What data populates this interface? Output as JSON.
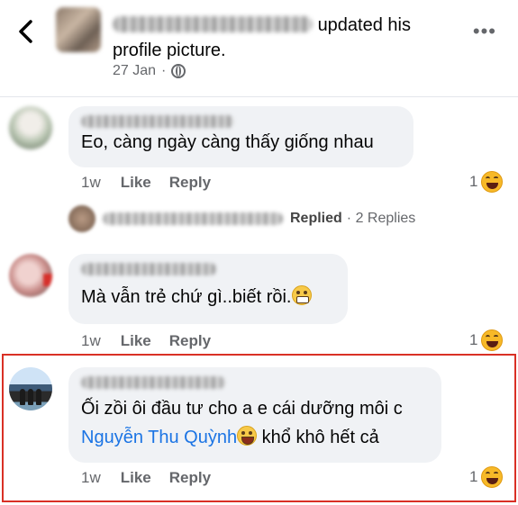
{
  "header": {
    "action_text": "updated his",
    "action_text_2": "profile picture.",
    "date": "27 Jan",
    "separator": "·"
  },
  "comments": [
    {
      "text": "Eo, càng ngày càng thấy giống nhau",
      "time": "1w",
      "like_label": "Like",
      "reply_label": "Reply",
      "reaction_count": "1"
    },
    {
      "text": "Mà vẫn trẻ chứ gì..biết rồi.",
      "time": "1w",
      "like_label": "Like",
      "reply_label": "Reply",
      "reaction_count": "1"
    },
    {
      "text_line1": "Ối zồi ôi đầu tư cho a e cái dưỡng môi c",
      "tagged_name": "Nguyễn Thu Quỳnh",
      "text_line2_rest": " khổ khô hết cả",
      "time": "1w",
      "like_label": "Like",
      "reply_label": "Reply",
      "reaction_count": "1"
    }
  ],
  "replies": {
    "label": "Replied",
    "count_text": "· 2 Replies"
  },
  "icons": {
    "back": "chevron-left-icon",
    "more": "more-dots-icon",
    "privacy": "globe-icon",
    "reaction": "haha-reaction-icon"
  },
  "colors": {
    "link": "#1b74e4",
    "meta": "#65676b",
    "bubble": "#f0f2f5",
    "highlight": "#d93025"
  }
}
